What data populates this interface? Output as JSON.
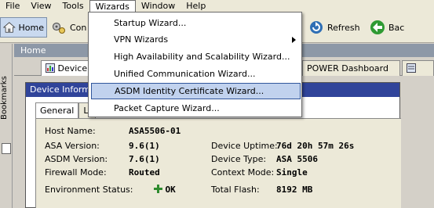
{
  "menubar": {
    "items": [
      "File",
      "View",
      "Tools",
      "Wizards",
      "Window",
      "Help"
    ]
  },
  "toolbar": {
    "home_label": "Home",
    "config_label": "Con",
    "refresh_label": "Refresh",
    "back_label": "Bac"
  },
  "bookmarks": {
    "label": "Bookmarks"
  },
  "home_strip": {
    "title": "Home"
  },
  "dashboard_tabs": {
    "device": "Device",
    "power": "POWER Dashboard"
  },
  "wizards_menu": {
    "items": [
      "Startup Wizard...",
      "VPN Wizards",
      "High Availability and Scalability Wizard...",
      "Unified Communication Wizard...",
      "ASDM Identity Certificate Wizard...",
      "Packet Capture Wizard..."
    ]
  },
  "panel": {
    "title": "Device Inform",
    "tabs": [
      "General",
      "Li"
    ],
    "fields": {
      "host_name_label": "Host Name:",
      "host_name": "ASA5506-01",
      "asa_version_label": "ASA Version:",
      "asa_version": "9.6(1)",
      "asdm_version_label": "ASDM Version:",
      "asdm_version": "7.6(1)",
      "firewall_mode_label": "Firewall Mode:",
      "firewall_mode": "Routed",
      "env_status_label": "Environment Status:",
      "env_status": "OK",
      "uptime_label": "Device Uptime:",
      "uptime": "76d 20h 57m 26s",
      "device_type_label": "Device Type:",
      "device_type": "ASA 5506",
      "context_mode_label": "Context Mode:",
      "context_mode": "Single",
      "total_flash_label": "Total Flash:",
      "total_flash": "8192 MB"
    }
  },
  "colors": {
    "panel_title_bg": "#30449a",
    "menu_highlight": "#c1d2ee",
    "env_ok": "#2e8b2e"
  }
}
